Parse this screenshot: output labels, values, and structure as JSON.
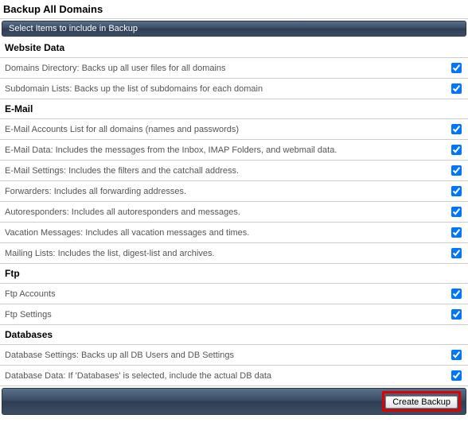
{
  "title": "Backup All Domains",
  "sectionBar": "Select Items to include in Backup",
  "groups": [
    {
      "header": "Website Data",
      "items": [
        {
          "label": "Domains Directory: Backs up all user files for all domains",
          "checked": true
        },
        {
          "label": "Subdomain Lists: Backs up the list of subdomains for each domain",
          "checked": true
        }
      ]
    },
    {
      "header": "E-Mail",
      "items": [
        {
          "label": "E-Mail Accounts List for all domains (names and passwords)",
          "checked": true
        },
        {
          "label": "E-Mail Data: Includes the messages from the Inbox, IMAP Folders, and webmail data.",
          "checked": true
        },
        {
          "label": "E-Mail Settings: Includes the filters and the catchall address.",
          "checked": true
        },
        {
          "label": "Forwarders: Includes all forwarding addresses.",
          "checked": true
        },
        {
          "label": "Autoresponders: Includes all autoresponders and messages.",
          "checked": true
        },
        {
          "label": "Vacation Messages: Includes all vacation messages and times.",
          "checked": true
        },
        {
          "label": "Mailing Lists: Includes the list, digest-list and archives.",
          "checked": true
        }
      ]
    },
    {
      "header": "Ftp",
      "items": [
        {
          "label": "Ftp Accounts",
          "checked": true
        },
        {
          "label": "Ftp Settings",
          "checked": true
        }
      ]
    },
    {
      "header": "Databases",
      "items": [
        {
          "label": "Database Settings: Backs up all DB Users and DB Settings",
          "checked": true
        },
        {
          "label": "Database Data: If 'Databases' is selected, include the actual DB data",
          "checked": true
        }
      ]
    }
  ],
  "createButton": "Create Backup"
}
